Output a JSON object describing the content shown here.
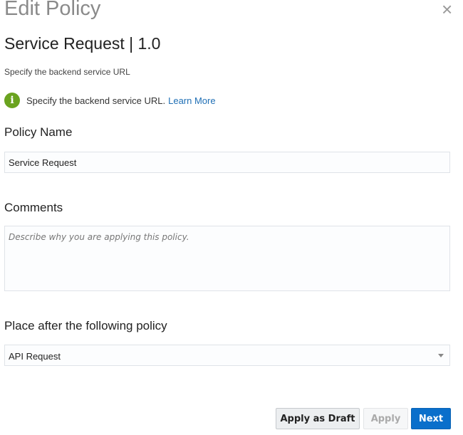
{
  "dialog": {
    "title": "Edit Policy",
    "close_icon": "×"
  },
  "policy": {
    "heading": "Service Request | 1.0",
    "description": "Specify the backend service URL",
    "info_text": "Specify the backend service URL.",
    "learn_more": "Learn More",
    "info_icon": "i"
  },
  "form": {
    "name_label": "Policy Name",
    "name_value": "Service Request",
    "comments_label": "Comments",
    "comments_placeholder": "Describe why you are applying this policy.",
    "place_label": "Place after the following policy",
    "place_value": "API Request"
  },
  "buttons": {
    "draft": "Apply as Draft",
    "apply": "Apply",
    "next": "Next"
  }
}
